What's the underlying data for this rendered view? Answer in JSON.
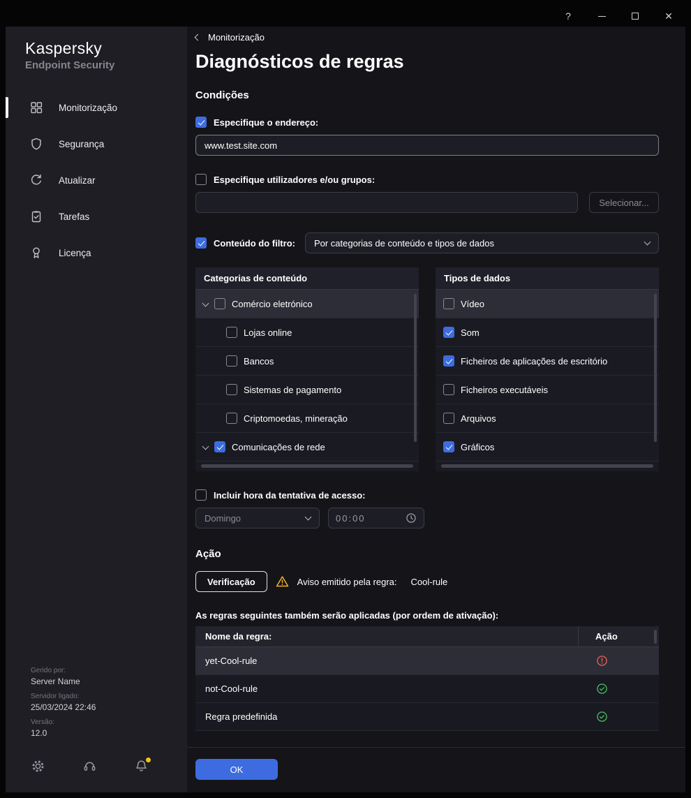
{
  "colors": {
    "accent": "#3d6ce0",
    "warning": "#f0b429",
    "danger": "#e05c5c",
    "success": "#45b860"
  },
  "window": {
    "help": "?",
    "close": "✕"
  },
  "sidebar": {
    "brand_title": "Kaspersky",
    "brand_subtitle": "Endpoint Security",
    "items": [
      {
        "label": "Monitorização"
      },
      {
        "label": "Segurança"
      },
      {
        "label": "Atualizar"
      },
      {
        "label": "Tarefas"
      },
      {
        "label": "Licença"
      }
    ],
    "footer": {
      "managed_label": "Gerido por:",
      "managed_value": "Server Name",
      "server_label": "Servidor ligado:",
      "server_value": "25/03/2024 22:46",
      "version_label": "Versão:",
      "version_value": "12.0"
    }
  },
  "header": {
    "breadcrumb": "Monitorização",
    "title": "Diagnósticos de regras"
  },
  "conditions": {
    "title": "Condições",
    "address": {
      "label": "Especifique o endereço:",
      "checked": true,
      "value": "www.test.site.com"
    },
    "users": {
      "label": "Especifique utilizadores e/ou grupos:",
      "checked": false,
      "value": "",
      "button": "Selecionar..."
    },
    "filter": {
      "label": "Conteúdo do filtro:",
      "checked": true,
      "selected": "Por categorias de conteúdo e tipos de dados"
    },
    "categories": {
      "header": "Categorias de conteúdo",
      "rows": [
        {
          "label": "Comércio eletrónico",
          "checked": false
        },
        {
          "label": "Lojas online",
          "checked": false
        },
        {
          "label": "Bancos",
          "checked": false
        },
        {
          "label": "Sistemas de pagamento",
          "checked": false
        },
        {
          "label": "Criptomoedas, mineração",
          "checked": false
        },
        {
          "label": "Comunicações de rede",
          "checked": true
        }
      ]
    },
    "datatypes": {
      "header": "Tipos de dados",
      "rows": [
        {
          "label": "Vídeo",
          "checked": false
        },
        {
          "label": "Som",
          "checked": true
        },
        {
          "label": "Ficheiros de aplicações de escritório",
          "checked": true
        },
        {
          "label": "Ficheiros executáveis",
          "checked": false
        },
        {
          "label": "Arquivos",
          "checked": false
        },
        {
          "label": "Gráficos",
          "checked": true
        }
      ]
    },
    "time": {
      "label": "Incluir hora da tentativa de acesso:",
      "checked": false,
      "day": "Domingo",
      "value": "00:00"
    }
  },
  "action": {
    "title": "Ação",
    "verify_button": "Verificação",
    "warning_text": "Aviso emitido pela regra:",
    "warning_rule": "Cool-rule",
    "table_caption": "As regras seguintes também serão aplicadas (por ordem de ativação):",
    "columns": {
      "name": "Nome da regra:",
      "action": "Ação"
    },
    "rows": [
      {
        "name": "yet-Cool-rule",
        "status": "warning"
      },
      {
        "name": "not-Cool-rule",
        "status": "ok"
      },
      {
        "name": "Regra predefinida",
        "status": "ok"
      }
    ]
  },
  "footer": {
    "ok": "OK"
  }
}
